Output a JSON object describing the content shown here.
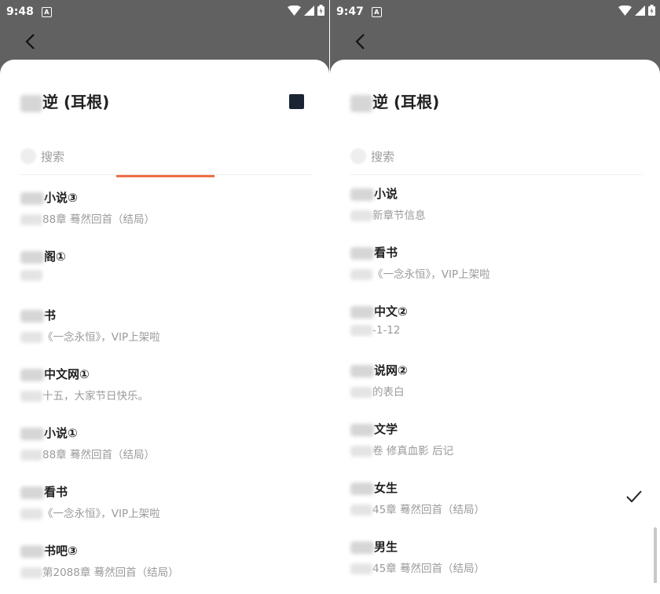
{
  "left_screen": {
    "status": {
      "time": "9:48",
      "notif": "A"
    },
    "sheet_title": "逆 (耳根)",
    "search_placeholder": "搜索",
    "items": [
      {
        "title": "小说③",
        "subtitle": "88章 蓦然回首（结局）"
      },
      {
        "title": "阁①",
        "subtitle": ""
      },
      {
        "title": "书",
        "subtitle": "《一念永恒》，VIP上架啦"
      },
      {
        "title": "中文网①",
        "subtitle": "十五，大家节日快乐。"
      },
      {
        "title": "小说①",
        "subtitle": "88章 蓦然回首（结局）"
      },
      {
        "title": "看书",
        "subtitle": "《一念永恒》，VIP上架啦"
      },
      {
        "title": "书吧③",
        "subtitle": "第2088章 蓦然回首（结局）"
      }
    ]
  },
  "right_screen": {
    "status": {
      "time": "9:47",
      "notif": "A"
    },
    "sheet_title": "逆 (耳根)",
    "search_placeholder": "搜索",
    "items": [
      {
        "title": "小说",
        "subtitle": "新章节信息"
      },
      {
        "title": "看书",
        "subtitle": "《一念永恒》，VIP上架啦"
      },
      {
        "title": "中文②",
        "subtitle": "-1-12"
      },
      {
        "title": "说网②",
        "subtitle": "的表白"
      },
      {
        "title": "文学",
        "subtitle": "卷 修真血影 后记"
      },
      {
        "title": "女生",
        "subtitle": "45章 蓦然回首（结局）"
      },
      {
        "title": "男生",
        "subtitle": "45章 蓦然回首（结局）"
      }
    ]
  },
  "icons": {
    "back": "back-arrow-icon",
    "stop": "stop-icon",
    "check": "check-icon",
    "wifi": "wifi-icon",
    "signal": "signal-icon",
    "battery": "battery-icon"
  },
  "colors": {
    "status_bar": "#616161",
    "tab_indicator": "#ee6d45",
    "stop_button": "#1b2433"
  }
}
